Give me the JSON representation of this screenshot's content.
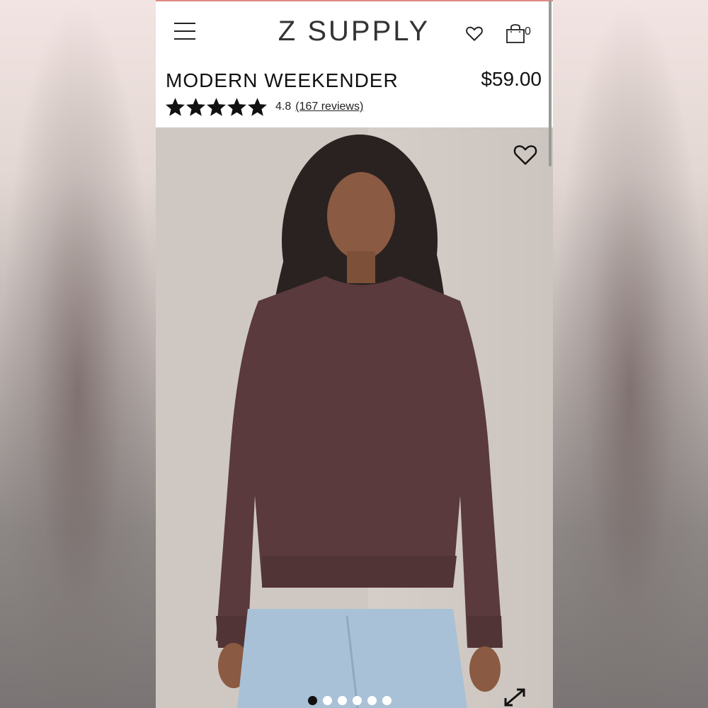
{
  "header": {
    "brand": "Z SUPPLY",
    "cart_count": "0",
    "icons": {
      "menu": "hamburger-menu-icon",
      "wishlist": "heart-outline-icon",
      "cart": "shopping-bag-icon"
    }
  },
  "product": {
    "title": "MODERN WEEKENDER",
    "price": "$59.00",
    "rating": "4.8",
    "stars_filled": 5,
    "stars_total": 5,
    "reviews_link": "(167 reviews)"
  },
  "gallery": {
    "slide_count": 6,
    "active_slide": 1,
    "icons": {
      "favorite": "heart-outline-icon",
      "expand": "expand-arrows-icon"
    }
  },
  "colors": {
    "accent": "#e08985",
    "text": "#111111",
    "sweater": "#5a3a3c",
    "background": "#d3cbc5"
  }
}
